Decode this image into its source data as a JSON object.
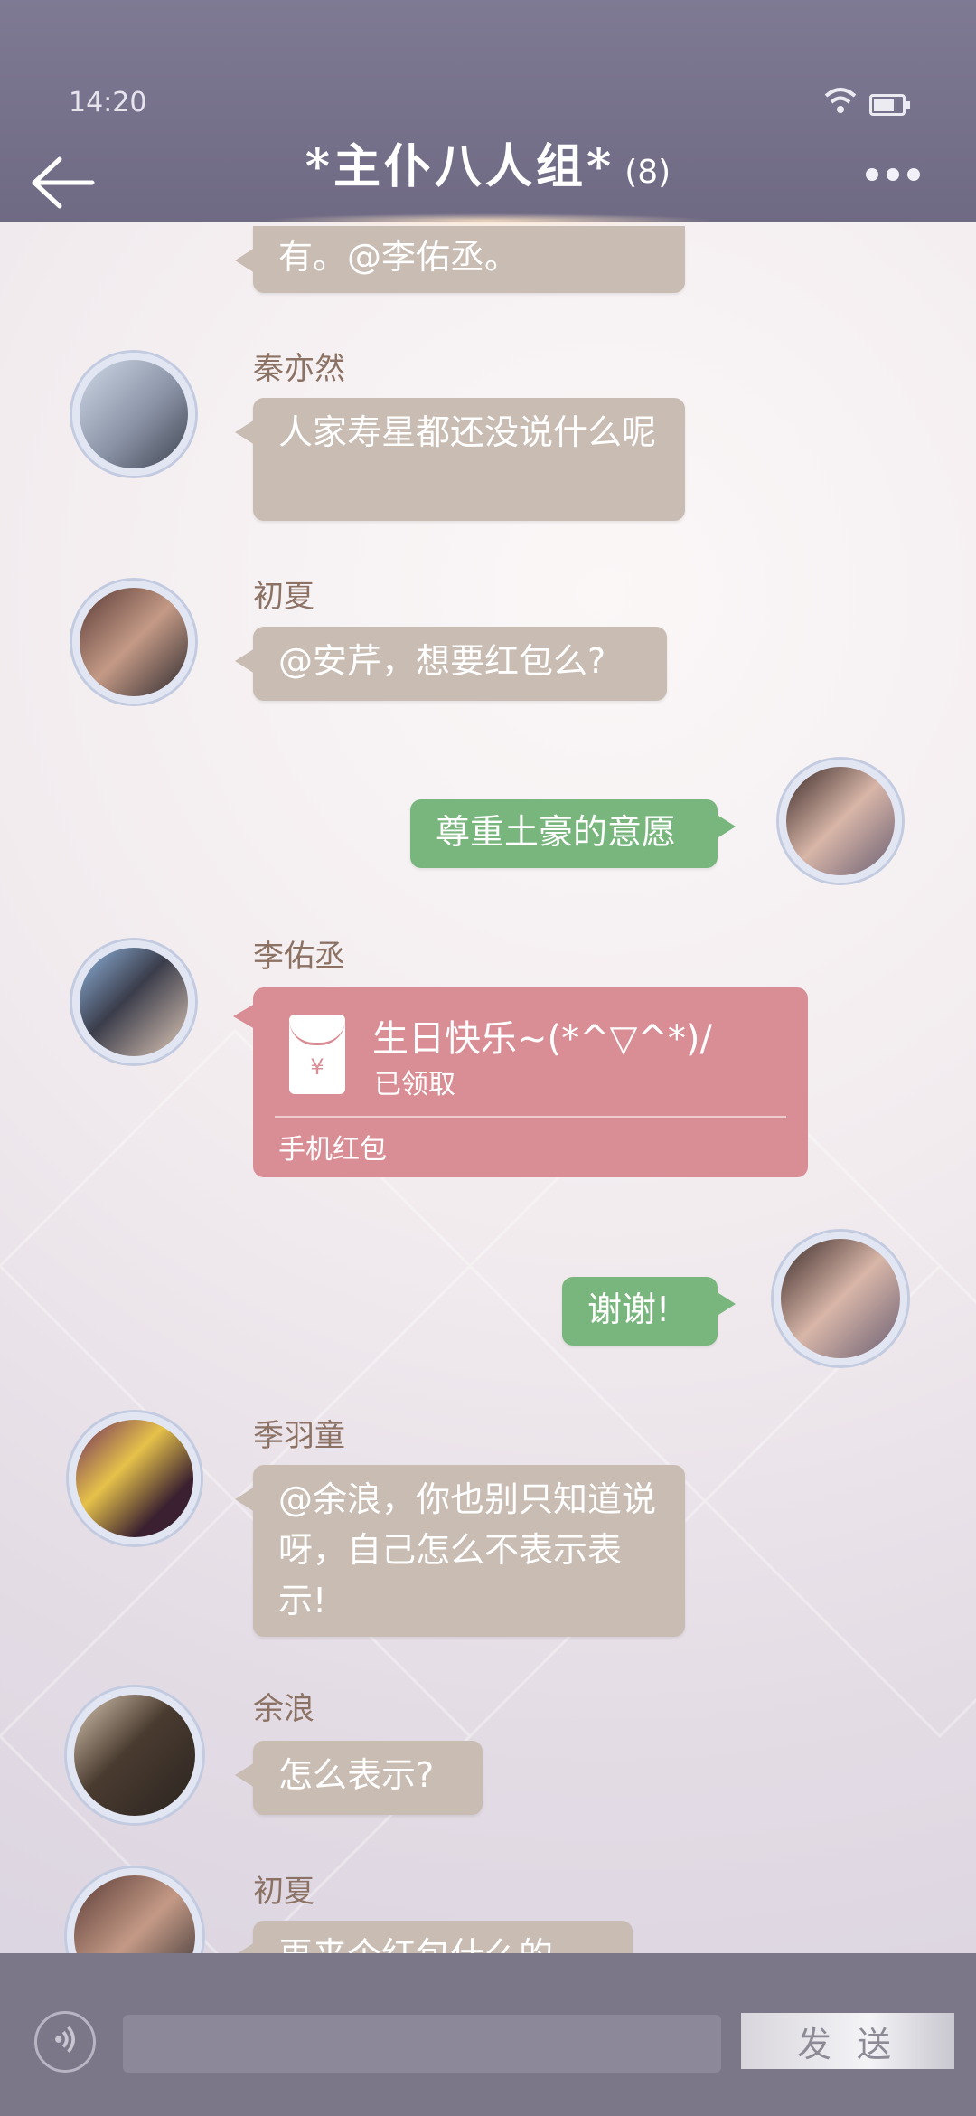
{
  "status_bar": {
    "time": "14:20"
  },
  "header": {
    "title": "*主仆八人组*",
    "member_count": "(8)"
  },
  "messages": [
    {
      "sender": "",
      "text": "有。@李佑丞。",
      "direction": "in"
    },
    {
      "sender": "秦亦然",
      "text": "人家寿星都还没说什么呢",
      "direction": "in"
    },
    {
      "sender": "初夏",
      "text": "@安芹，想要红包么?",
      "direction": "in"
    },
    {
      "sender": "",
      "text": "尊重土豪的意愿",
      "direction": "out"
    },
    {
      "sender": "李佑丞",
      "type": "red_packet",
      "direction": "in",
      "red_packet": {
        "title": "生日快乐~(*^▽^*)/",
        "status": "已领取",
        "footer": "手机红包",
        "currency_symbol": "¥"
      }
    },
    {
      "sender": "",
      "text": "谢谢!",
      "direction": "out"
    },
    {
      "sender": "季羽童",
      "text": "@余浪，你也别只知道说呀，自己怎么不表示表示!",
      "direction": "in"
    },
    {
      "sender": "余浪",
      "text": "怎么表示?",
      "direction": "in"
    },
    {
      "sender": "初夏",
      "text": "再来个红包什么的",
      "direction": "in"
    }
  ],
  "input_bar": {
    "send_label": "发 送",
    "input_value": ""
  },
  "colors": {
    "header": "#7f7a93",
    "incoming_bubble": "#c8bcb3",
    "outgoing_bubble": "#79b67d",
    "red_packet": "#d98d94",
    "sender_name": "#8c7264"
  }
}
